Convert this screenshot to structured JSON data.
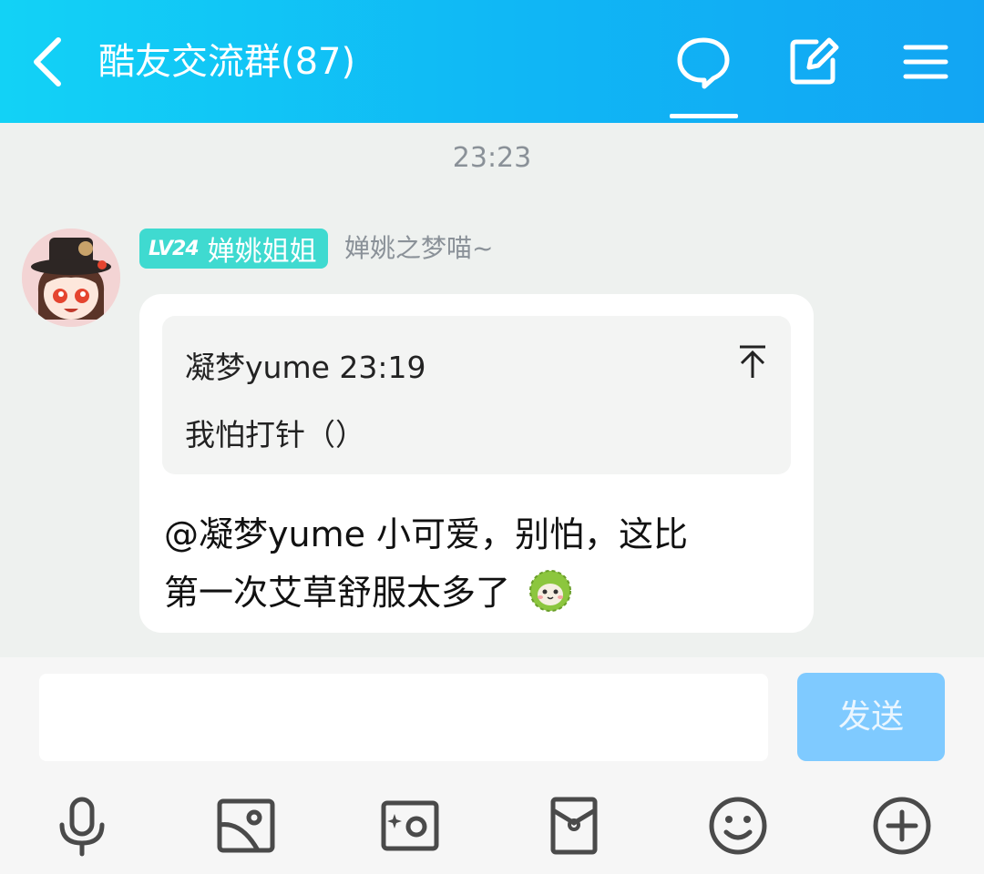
{
  "header": {
    "title": "酷友交流群(87)",
    "icons": [
      "back-icon",
      "chat-bubble-icon",
      "edit-icon",
      "menu-icon"
    ],
    "color_start": "#12d2f6",
    "color_end": "#12a5f3"
  },
  "messages": {
    "timestamp": "23:23",
    "sender": {
      "level": "LV24",
      "title": "婵姚姐姐",
      "nickname": "婵姚之梦喵~",
      "badge_color": "#3fdad0"
    },
    "quote": {
      "author_time": "凝梦yume 23:19",
      "text": "我怕打针（）"
    },
    "message_lines": [
      "@凝梦yume 小可爱，别怕，这比",
      "第一次艾草舒服太多了"
    ]
  },
  "input": {
    "placeholder": "",
    "send_label": "发送",
    "send_color": "#7fcaff"
  },
  "toolbar": {
    "icons": [
      "microphone-icon",
      "image-icon",
      "camera-icon",
      "red-packet-icon",
      "emoji-icon",
      "plus-icon"
    ]
  }
}
